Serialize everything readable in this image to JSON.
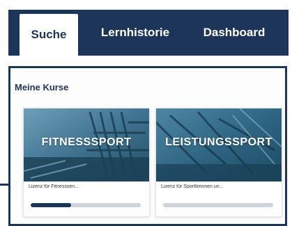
{
  "tabs": [
    {
      "label": "Suche",
      "active": true
    },
    {
      "label": "Lernhistorie",
      "active": false
    },
    {
      "label": "Dashboard",
      "active": false
    }
  ],
  "section": {
    "title": "Meine Kurse"
  },
  "courses": [
    {
      "image_title": "FITNESSSPORT",
      "subtitle": "Lizenz für Fitnesssen...",
      "progress": 0.37
    },
    {
      "image_title": "LEISTUNGSSPORT",
      "subtitle": "Lizenz für Sportlerinnen un...",
      "progress": 0.0
    }
  ],
  "colors": {
    "brand": "#1c3558",
    "accent": "#ffffff",
    "progress_track": "#cfd4da"
  }
}
